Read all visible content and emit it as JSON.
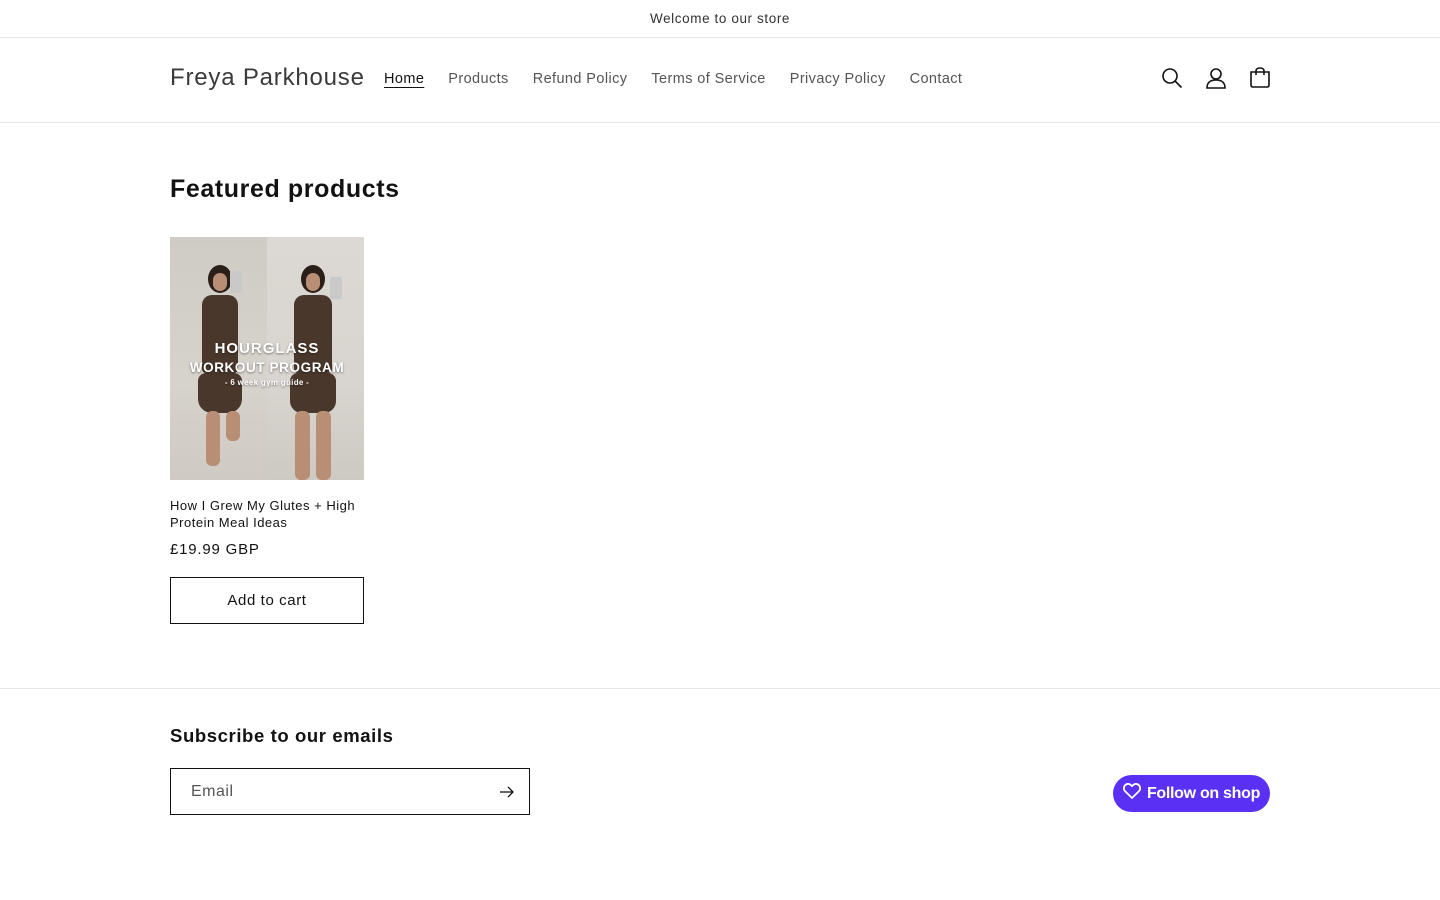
{
  "announcement": {
    "text": "Welcome to our store"
  },
  "header": {
    "logo": "Freya Parkhouse",
    "nav": [
      {
        "label": "Home",
        "active": true
      },
      {
        "label": "Products"
      },
      {
        "label": "Refund Policy"
      },
      {
        "label": "Terms of Service"
      },
      {
        "label": "Privacy Policy"
      },
      {
        "label": "Contact"
      }
    ],
    "icons": [
      "search-icon",
      "account-icon",
      "cart-icon"
    ]
  },
  "featured": {
    "title": "Featured products",
    "products": [
      {
        "image_text": {
          "line1": "HOURGLASS",
          "line2": "WORKOUT PROGRAM",
          "line3": "- 6 week gym guide -"
        },
        "title": "How I Grew My Glutes + High Protein Meal Ideas",
        "price": "£19.99 GBP",
        "button": "Add to cart"
      }
    ]
  },
  "footer": {
    "subscribe_title": "Subscribe to our emails",
    "email_placeholder": "Email",
    "follow_button": "Follow on shop",
    "colors": {
      "shop_purple": "#5a31f4"
    }
  }
}
